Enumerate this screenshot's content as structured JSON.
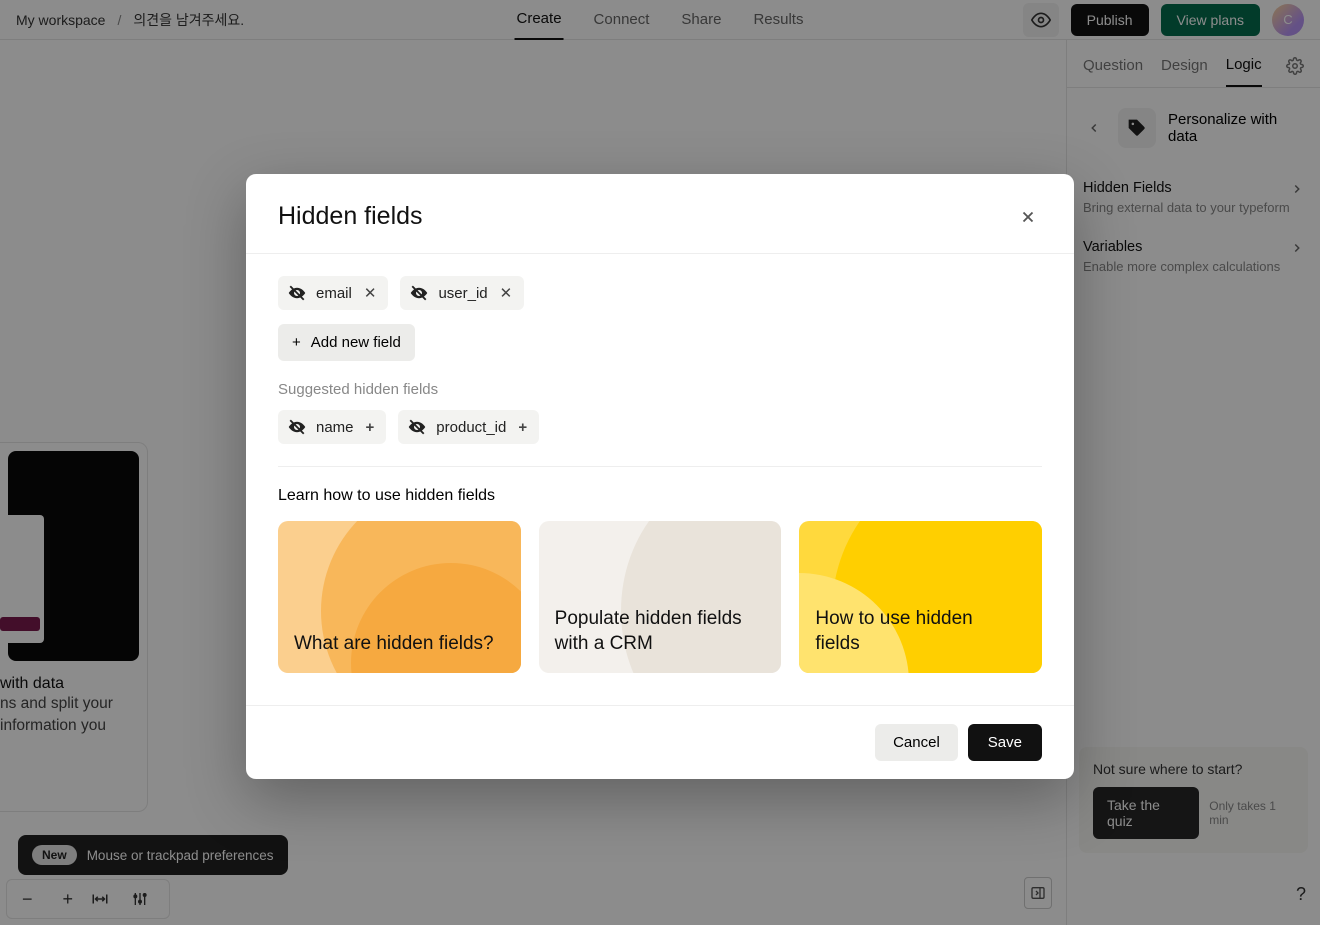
{
  "breadcrumb": {
    "workspace": "My workspace",
    "separator": "/",
    "form_name": "의견을 남겨주세요."
  },
  "topnav": {
    "create": "Create",
    "connect": "Connect",
    "share": "Share",
    "results": "Results"
  },
  "topright": {
    "publish": "Publish",
    "view_plans": "View plans",
    "avatar_initial": "C"
  },
  "rightbar": {
    "tabs": {
      "question": "Question",
      "design": "Design",
      "logic": "Logic"
    },
    "personalize": "Personalize with data",
    "items": [
      {
        "title": "Hidden Fields",
        "sub": "Bring external data to your typeform"
      },
      {
        "title": "Variables",
        "sub": "Enable more complex calculations"
      }
    ],
    "start_prompt": {
      "q": "Not sure where to start?",
      "quiz": "Take the quiz",
      "hint": "Only takes 1 min"
    }
  },
  "canvas_card": {
    "line1": "with data",
    "line2": "ns and split your",
    "line3": "information you"
  },
  "notif": {
    "badge": "New",
    "text": "Mouse or trackpad preferences"
  },
  "modal": {
    "title": "Hidden fields",
    "fields": [
      {
        "name": "email"
      },
      {
        "name": "user_id"
      }
    ],
    "add_field": "Add new field",
    "suggested_label": "Suggested hidden fields",
    "suggested": [
      {
        "name": "name"
      },
      {
        "name": "product_id"
      }
    ],
    "learn_title": "Learn how to use hidden fields",
    "cards": [
      {
        "title": "What are hidden fields?"
      },
      {
        "title": "Populate hidden fields with a CRM"
      },
      {
        "title": "How to use hidden fields"
      }
    ],
    "cancel": "Cancel",
    "save": "Save"
  }
}
